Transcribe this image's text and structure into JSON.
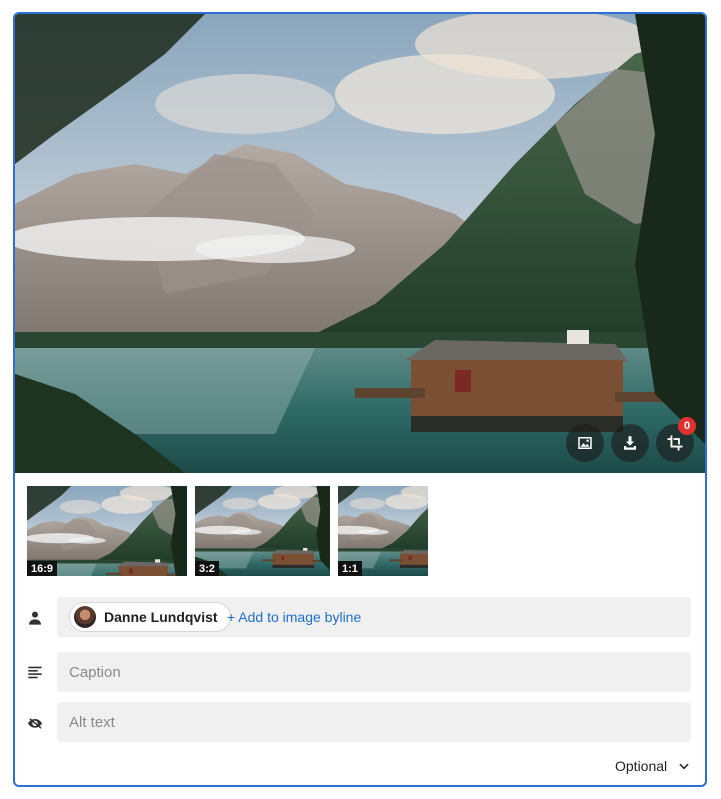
{
  "image": {
    "description_alt": "",
    "toolbar": {
      "replace_icon": "image-icon",
      "download_icon": "download-icon",
      "crop_icon": "crop-icon",
      "crop_badge_count": "0"
    }
  },
  "crops": [
    {
      "label": "16:9"
    },
    {
      "label": "3:2"
    },
    {
      "label": "1:1"
    }
  ],
  "byline": {
    "icon": "person-icon",
    "author_name": "Danne Lundqvist",
    "add_link": "+ Add to image byline"
  },
  "caption": {
    "icon": "text-lines-icon",
    "placeholder": "Caption",
    "value": ""
  },
  "alt_text": {
    "icon": "eye-off-icon",
    "placeholder": "Alt text",
    "value": ""
  },
  "optional": {
    "label": "Optional",
    "icon": "chevron-down-icon"
  },
  "colors": {
    "border_accent": "#2f6fd4",
    "link": "#1f6fcf",
    "badge": "#e03131"
  }
}
